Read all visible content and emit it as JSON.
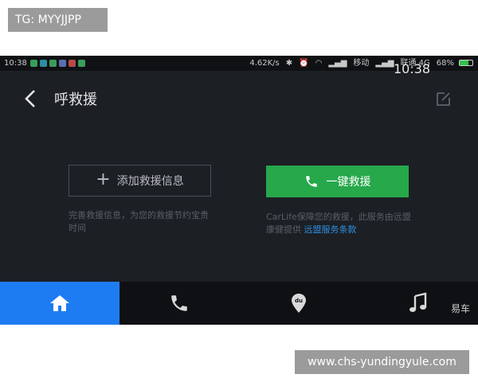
{
  "watermarks": {
    "top": "TG: MYYJJPP",
    "bottom": "www.chs-yundingyule.com"
  },
  "status_bar": {
    "time": "10:38",
    "speed": "4.62K/s",
    "carrier1": "移动",
    "carrier2": "联通 4G",
    "battery": "68%",
    "clock_overlay": "10:38",
    "colors": {
      "battery_fill": "#33c24a"
    }
  },
  "header": {
    "title": "呼救援"
  },
  "actions": {
    "add_label": "添加救援信息",
    "sos_label": "一键救援"
  },
  "descriptions": {
    "left": "完善救援信息，为您的救援节约宝贵时间",
    "right_text": "CarLife保障您的救援，此服务由远盟康健提供 ",
    "right_link": "远盟服务条款"
  },
  "tabs": [
    {
      "name": "home",
      "icon": "home-icon",
      "active": true
    },
    {
      "name": "phone",
      "icon": "phone-icon",
      "active": false
    },
    {
      "name": "map",
      "icon": "map-pin-icon",
      "active": false
    },
    {
      "name": "music",
      "icon": "music-note-icon",
      "active": false
    }
  ],
  "brand": "易车",
  "colors": {
    "accent_green": "#26a84b",
    "accent_blue": "#1e7cf2",
    "link_blue": "#2f8fe0"
  }
}
